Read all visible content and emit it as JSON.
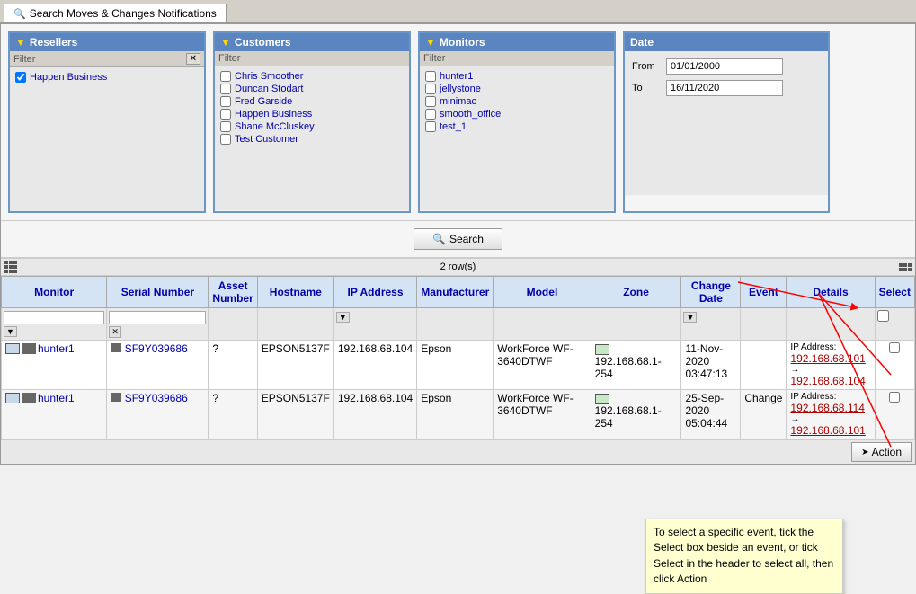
{
  "tab": {
    "label": "Search Moves & Changes Notifications",
    "icon": "search-icon"
  },
  "resellers": {
    "header": "Resellers",
    "filter_placeholder": "Filter",
    "items": [
      {
        "label": "Happen Business",
        "checked": true
      }
    ]
  },
  "customers": {
    "header": "Customers",
    "filter_placeholder": "Filter",
    "items": [
      {
        "label": "Chris Smoother",
        "checked": false
      },
      {
        "label": "Duncan Stodart",
        "checked": false
      },
      {
        "label": "Fred Garside",
        "checked": false
      },
      {
        "label": "Happen Business",
        "checked": false
      },
      {
        "label": "Shane McCluskey",
        "checked": false
      },
      {
        "label": "Test Customer",
        "checked": false
      }
    ]
  },
  "monitors": {
    "header": "Monitors",
    "filter_placeholder": "Filter",
    "items": [
      {
        "label": "hunter1",
        "checked": false
      },
      {
        "label": "jellystone",
        "checked": false
      },
      {
        "label": "minimac",
        "checked": false
      },
      {
        "label": "smooth_office",
        "checked": false
      },
      {
        "label": "test_1",
        "checked": false
      }
    ]
  },
  "date": {
    "header": "Date",
    "from_label": "From",
    "to_label": "To",
    "from_value": "01/01/2000",
    "to_value": "16/11/2020"
  },
  "search_button": "Search",
  "tooltip": "To select a specific event, tick the Select box beside an event, or tick Select in the header to select all, then click Action",
  "results": {
    "row_count": "2 row(s)",
    "columns": [
      "Monitor",
      "Serial Number",
      "Asset Number",
      "Hostname",
      "IP Address",
      "Manufacturer",
      "Model",
      "Zone",
      "Change Date",
      "Event",
      "Details",
      "Select"
    ],
    "rows": [
      {
        "monitor": "hunter1",
        "serial": "SF9Y039686",
        "asset": "?",
        "hostname": "EPSON5137F",
        "ip": "192.168.68.104",
        "manufacturer": "Epson",
        "model": "WorkForce WF-3640DTWF",
        "zone": "192.168.68.1-254",
        "change_date": "11-Nov-2020 03:47:13",
        "event": "",
        "details": "IP Address: 192.168.68.101 → 192.168.68.104",
        "selected": false
      },
      {
        "monitor": "hunter1",
        "serial": "SF9Y039686",
        "asset": "?",
        "hostname": "EPSON5137F",
        "ip": "192.168.68.104",
        "manufacturer": "Epson",
        "model": "WorkForce WF-3640DTWF",
        "zone": "192.168.68.1-254",
        "change_date": "25-Sep-2020 05:04:44",
        "event": "Change",
        "details": "IP Address: 192.168.68.114 → 192.168.68.101",
        "selected": false
      }
    ]
  },
  "action_button": "Action"
}
